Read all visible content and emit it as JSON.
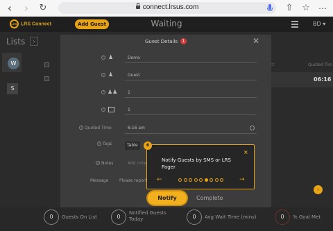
{
  "browser": {
    "url": "connect.lrsus.com",
    "back_icon": "chevron-left",
    "forward_icon": "chevron-right",
    "reload_icon": "reload"
  },
  "header": {
    "logo_text": "LRS Connect",
    "logo_ring_text": "LRS",
    "add_guest_label": "Add Guest",
    "title": "Waiting",
    "user_initials": "BD",
    "brand_color": "#e8a317"
  },
  "sidebar": {
    "title": "Lists",
    "items": [
      {
        "label": "W"
      },
      {
        "label": "S"
      }
    ]
  },
  "table": {
    "col_contact": "tact",
    "col_quoted": "Quoted Tim",
    "row_time": "06:16"
  },
  "modal": {
    "title": "Guest Details",
    "badge": "1",
    "fields": [
      {
        "value": "Demo"
      },
      {
        "value": "Guest"
      },
      {
        "value": "1"
      },
      {
        "value": "1"
      }
    ],
    "quoted_time_label": "Quoted Time",
    "quoted_time_value": "6:16 am",
    "tags_label": "Tags",
    "tag_value": "Table",
    "notes_label": "Notes",
    "notes_placeholder": "Add note",
    "message_label": "Message",
    "message_placeholder": "Please report",
    "notify_label": "Notify",
    "complete_label": "Complete"
  },
  "tour": {
    "step_badge": "6",
    "text": "Notify Guests by SMS or LRS Pager",
    "close": "×",
    "prev": "←",
    "next": "→",
    "total_steps": 9,
    "active_step": 6
  },
  "footer": {
    "stats": [
      {
        "value": "0",
        "label": "Guests On List"
      },
      {
        "value": "0",
        "label": "Notified Guests Today"
      },
      {
        "value": "0",
        "label": "Avg Wait Time (mins)"
      },
      {
        "value": "0",
        "label": "% Goal Met"
      }
    ]
  }
}
